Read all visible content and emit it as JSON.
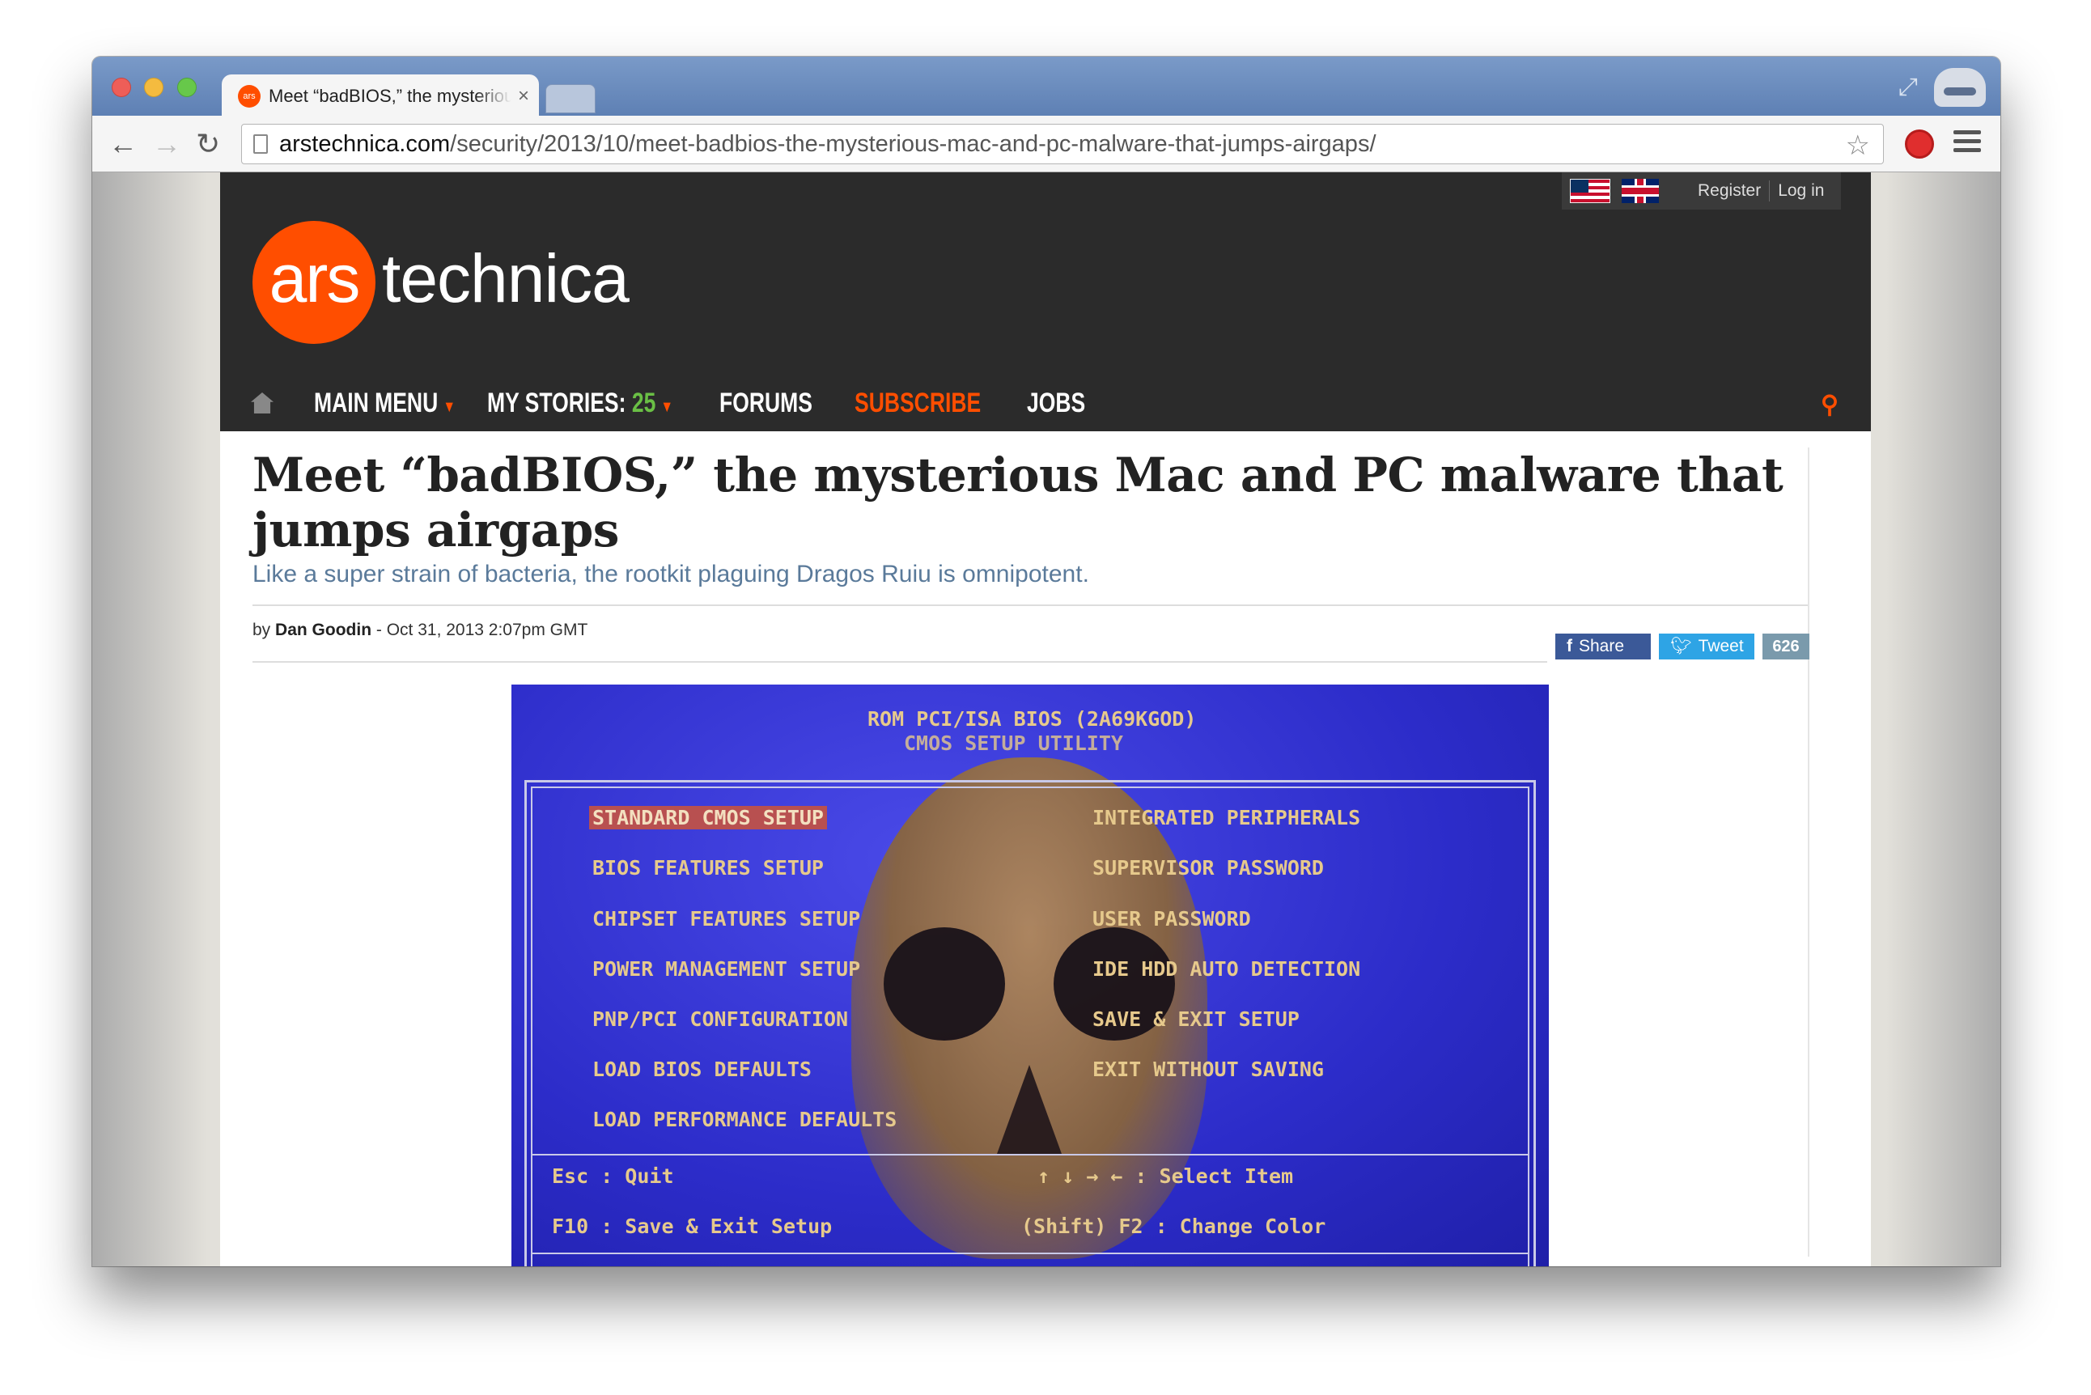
{
  "browser": {
    "tab_title": "Meet “badBIOS,” the mysterious Mac and PC malware that jumps airgaps",
    "tab_favicon_text": "ars",
    "url_domain": "arstechnica.com",
    "url_path": "/security/2013/10/meet-badbios-the-mysterious-mac-and-pc-malware-that-jumps-airgaps/",
    "icons": [
      "back-icon",
      "forward-icon",
      "reload-icon",
      "page-icon",
      "star-icon",
      "extension-icon",
      "menu-icon",
      "incognito-icon"
    ]
  },
  "site": {
    "logo_circle": "ars",
    "logo_text": "technica",
    "util": {
      "register": "Register",
      "login": "Log in"
    },
    "nav": {
      "main_menu": "MAIN MENU",
      "my_stories": "MY STORIES:",
      "my_stories_count": "25",
      "forums": "FORUMS",
      "subscribe": "SUBSCRIBE",
      "jobs": "JOBS"
    },
    "colors": {
      "brand_orange": "#ff4e00",
      "masthead": "#2b2b2b",
      "stories_count": "#6abf45"
    }
  },
  "article": {
    "headline": "Meet “badBIOS,” the mysterious Mac and PC malware that jumps airgaps",
    "subhead": "Like a super strain of bacteria, the rootkit plaguing Dragos Ruiu is omnipotent.",
    "byline_prefix": "by",
    "author": "Dan Goodin",
    "date": "- Oct 31, 2013 2:07pm GMT",
    "share_label": "Share",
    "tweet_label": "Tweet",
    "share_count": "626"
  },
  "hero": {
    "title1": "ROM PCI/ISA BIOS (2A69KGOD)",
    "title2": "CMOS SETUP UTILITY",
    "left_items": [
      "STANDARD CMOS SETUP",
      "BIOS FEATURES SETUP",
      "CHIPSET FEATURES SETUP",
      "POWER MANAGEMENT SETUP",
      "PNP/PCI CONFIGURATION",
      "LOAD BIOS DEFAULTS",
      "LOAD PERFORMANCE DEFAULTS"
    ],
    "right_items": [
      "INTEGRATED PERIPHERALS",
      "SUPERVISOR PASSWORD",
      "USER PASSWORD",
      "IDE HDD AUTO DETECTION",
      "SAVE & EXIT SETUP",
      "EXIT WITHOUT SAVING"
    ],
    "footer_left1": "Esc : Quit",
    "footer_left2": "F10 : Save & Exit Setup",
    "footer_right1": "↑ ↓ → ← : Select Item",
    "footer_right2": "(Shift) F2 : Change Color"
  }
}
